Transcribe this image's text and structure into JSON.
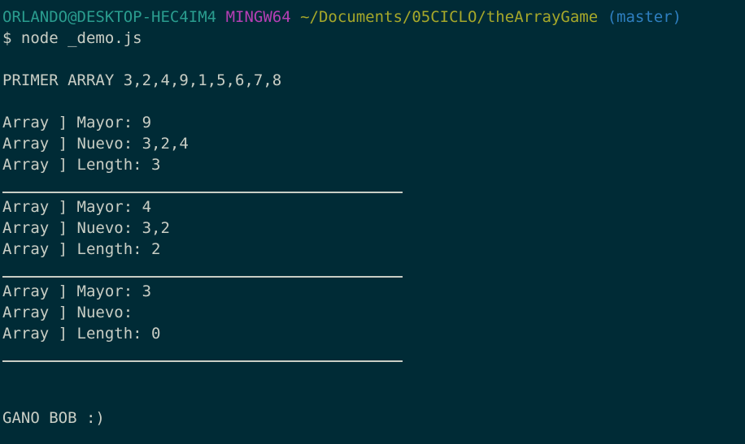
{
  "prompt": {
    "user_host": "ORLANDO@DESKTOP-HEC4IM4",
    "system": "MINGW64",
    "path": "~/Documents/05CICLO/theArrayGame",
    "branch": "(master)"
  },
  "command": "$ node _demo.js",
  "output": {
    "first_array": "PRIMER ARRAY 3,2,4,9,1,5,6,7,8",
    "blocks": [
      {
        "mayor": "Array ] Mayor: 9",
        "nuevo": "Array ] Nuevo: 3,2,4",
        "length": "Array ] Length: 3"
      },
      {
        "mayor": "Array ] Mayor: 4",
        "nuevo": "Array ] Nuevo: 3,2",
        "length": "Array ] Length: 2"
      },
      {
        "mayor": "Array ] Mayor: 3",
        "nuevo": "Array ] Nuevo:",
        "length": "Array ] Length: 0"
      }
    ],
    "result": "GANO BOB :)"
  },
  "colors": {
    "background": "#002b36",
    "text": "#c9cec5",
    "user_host": "#2a9d8f",
    "system": "#b63fb5",
    "path": "#a6a82a",
    "branch": "#2e7fc0"
  }
}
